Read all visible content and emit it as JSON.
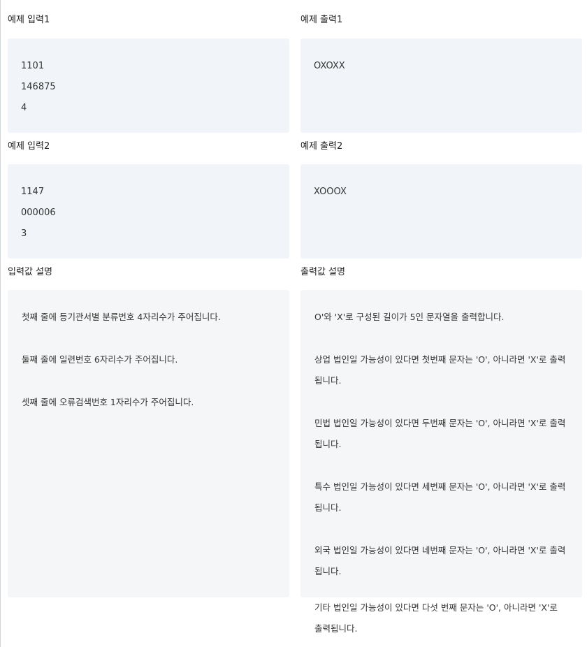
{
  "examples": [
    {
      "input_title": "예제 입력1",
      "input_lines": [
        "1101",
        "146875",
        "4"
      ],
      "output_title": "예제 출력1",
      "output_lines": [
        "OXOXX"
      ]
    },
    {
      "input_title": "예제 입력2",
      "input_lines": [
        "1147",
        "000006",
        "3"
      ],
      "output_title": "예제 출력2",
      "output_lines": [
        "XOOOX"
      ]
    }
  ],
  "input_desc": {
    "title": "입력값 설명",
    "paragraphs": [
      "첫째 줄에 등기관서별 분류번호 4자리수가 주어집니다.",
      "둘째 줄에 일련번호 6자리수가 주어집니다.",
      "셋째 줄에 오류검색번호 1자리수가 주어집니다."
    ]
  },
  "output_desc": {
    "title": "출력값 설명",
    "paragraphs": [
      "O'와 'X'로 구성된 길이가 5인 문자열을 출력합니다.",
      "상업 법인일 가능성이 있다면 첫번째 문자는 'O', 아니라면 'X'로 출력됩니다.",
      "민법 법인일 가능성이 있다면 두번째 문자는 'O', 아니라면 'X'로 출력됩니다.",
      "특수 법인일 가능성이 있다면 세번째 문자는 'O', 아니라면 'X'로 출력됩니다.",
      "외국 법인일 가능성이 있다면 네번째 문자는 'O', 아니라면 'X'로 출력됩니다.",
      "기타 법인일 가능성이 있다면 다섯 번째 문자는 'O', 아니라면 'X'로 출력됩니다."
    ]
  }
}
